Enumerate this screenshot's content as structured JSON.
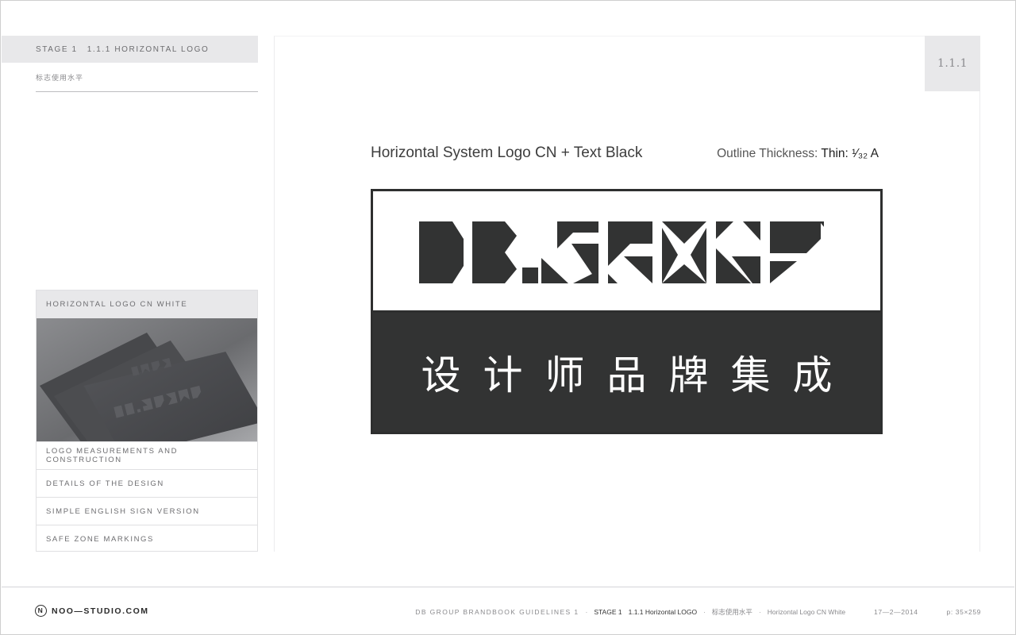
{
  "sidebar": {
    "stage_label": "STAGE 1",
    "section_label": "1.1.1 HORIZONTAL LOGO",
    "subtitle": "标志使用水平",
    "thumbnail": {
      "title": "HORIZONTAL LOGO CN WHITE",
      "links": [
        "LOGO MEASUREMENTS AND CONSTRUCTION",
        "DETAILS OF THE DESIGN",
        "SIMPLE ENGLISH SIGN VERSION",
        "SAFE ZONE MARKINGS"
      ]
    }
  },
  "main": {
    "page_badge": "1.1.1",
    "caption": "Horizontal System Logo CN + Text Black",
    "thickness_label": "Outline Thickness:",
    "thickness_value": "Thin: ¹⁄₃₂ A",
    "logo": {
      "wordmark": "DB.GROUP",
      "chinese_text": "设计师品牌集成"
    }
  },
  "footer": {
    "brand": "NOO—STUDIO.COM",
    "guidelines": "DB GROUP BRANDBOOK GUIDELINES 1",
    "stage": "STAGE 1",
    "section": "1.1.1 Horizontal LOGO",
    "subtitle_cn": "标志使用水平",
    "thumb_title": "Horizontal Logo CN White",
    "date": "17—2—2014",
    "page_number": "p: 35×259"
  },
  "colors": {
    "logo_dark": "#323333",
    "panel_grey": "#e8e8ea",
    "text_grey": "#6d6d70"
  }
}
